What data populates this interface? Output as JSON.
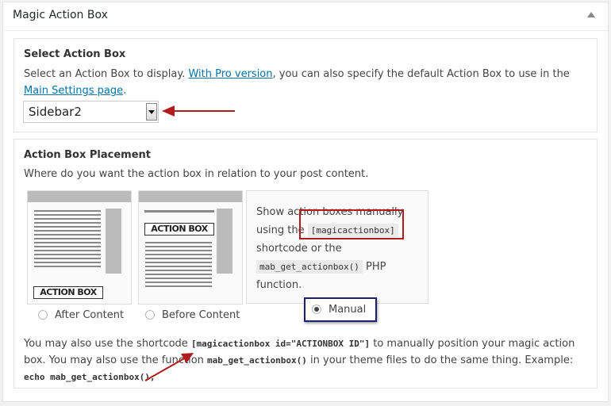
{
  "panel": {
    "title": "Magic Action Box"
  },
  "select_section": {
    "heading": "Select Action Box",
    "desc_part1": "Select an Action Box to display. ",
    "link1": "With Pro version",
    "desc_part2": ", you can also specify the default Action Box to use in the ",
    "link2": "Main Settings page",
    "desc_part3": ".",
    "dropdown_value": "Sidebar2"
  },
  "placement_section": {
    "heading": "Action Box Placement",
    "desc": "Where do you want the action box in relation to your post content.",
    "thumb_label": "ACTION BOX",
    "option_after": "After Content",
    "option_before": "Before Content",
    "option_manual": "Manual",
    "manual_text1": "Show action boxes manually using the",
    "manual_code1": "[magicactionbox]",
    "manual_text2": "shortcode or the",
    "manual_code2": "mab_get_actionbox()",
    "manual_text3": "PHP function.",
    "footer_text1": "You may also use the shortcode ",
    "footer_code1": "[magicactionbox id=\"ACTIONBOX ID\"]",
    "footer_text2": " to manually position your magic action box. You may also use the function ",
    "footer_code2": "mab_get_actionbox()",
    "footer_text3": " in your theme files to do the same thing. Example: ",
    "footer_code3": "echo mab_get_actionbox();",
    "selected": "Manual"
  },
  "colors": {
    "annotation_red": "#b01c1c",
    "annotation_blue": "#1a1f6e",
    "link": "#0073aa"
  }
}
